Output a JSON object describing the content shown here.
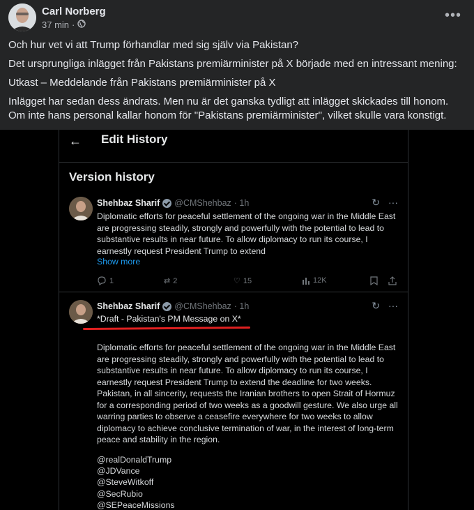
{
  "post": {
    "author": "Carl Norberg",
    "time": "37 min",
    "separator": "·",
    "more_icon": "more-horizontal-icon",
    "paragraphs": [
      "Och hur vet vi att Trump förhandlar med sig själv via Pakistan?",
      "Det ursprungliga inlägget från Pakistans premiärminister på X började med en intressant mening:",
      "Utkast – Meddelande från Pakistans premiärminister på X",
      "Inlägget har sedan dess ändrats. Men nu är det ganska tydligt att inlägget skickades till honom.",
      "Om inte hans personal kallar honom för \"Pakistans premiärminister\", vilket skulle vara konstigt."
    ]
  },
  "screenshot": {
    "header_title": "Edit History",
    "section_title": "Version history",
    "tweet1": {
      "name": "Shehbaz Sharif",
      "handle": "@CMShehbaz",
      "time": "· 1h",
      "body": "Diplomatic efforts for peaceful settlement of the ongoing war in the Middle East are progressing steadily, strongly and powerfully with the potential to lead to substantive results in near future. To allow diplomacy to run its course, I earnestly request President Trump to extend",
      "show_more": "Show more",
      "replies": "1",
      "reposts": "2",
      "likes": "15",
      "views": "12K"
    },
    "tweet2": {
      "name": "Shehbaz Sharif",
      "handle": "@CMShehbaz",
      "time": "· 1h",
      "draft_label": "*Draft - Pakistan's PM Message on X*",
      "body": "Diplomatic efforts for peaceful settlement of the ongoing war in the Middle East are progressing steadily, strongly and powerfully with the potential to lead to substantive results in near future. To allow diplomacy to run its course, I earnestly request President Trump to extend the deadline for two weeks. Pakistan, in all sincerity, requests the Iranian brothers to open Strait of Hormuz for a corresponding period of two weeks as a goodwill gesture. We also urge all warring parties to observe a ceasefire everywhere for two weeks to allow diplomacy to achieve conclusive termination of war, in the interest of long-term peace and stability in the region.",
      "mentions": [
        "@realDonaldTrump",
        "@JDVance",
        "@SteveWitkoff",
        "@SecRubio",
        "@SEPeaceMissions"
      ]
    },
    "colors": {
      "link": "#1d9bf0",
      "underline": "#e02020"
    }
  }
}
